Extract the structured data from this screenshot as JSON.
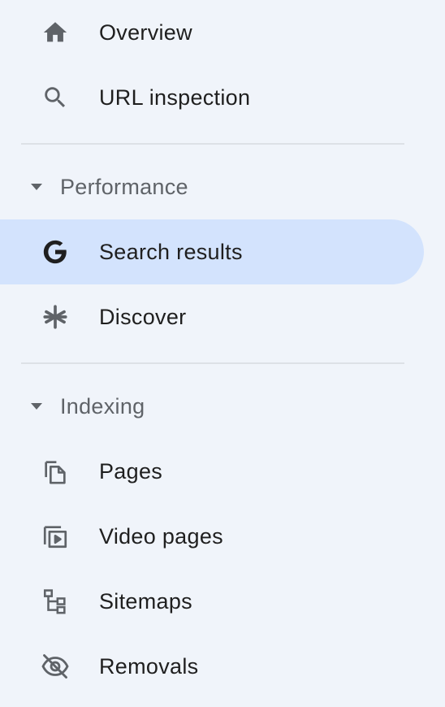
{
  "nav": {
    "items_top": [
      {
        "label": "Overview",
        "icon": "home-icon"
      },
      {
        "label": "URL inspection",
        "icon": "search-icon"
      }
    ],
    "performance": {
      "label": "Performance",
      "items": [
        {
          "label": "Search results",
          "icon": "google-g-icon",
          "active": true
        },
        {
          "label": "Discover",
          "icon": "asterisk-icon"
        }
      ]
    },
    "indexing": {
      "label": "Indexing",
      "items": [
        {
          "label": "Pages",
          "icon": "pages-icon"
        },
        {
          "label": "Video pages",
          "icon": "video-pages-icon"
        },
        {
          "label": "Sitemaps",
          "icon": "sitemap-icon"
        },
        {
          "label": "Removals",
          "icon": "eye-off-icon"
        }
      ]
    }
  },
  "colors": {
    "background": "#f0f4fa",
    "active_background": "#d3e3fd",
    "text": "#1f1f1f",
    "section_text": "#5f6368",
    "icon": "#5f6368",
    "divider": "#dde1e6"
  }
}
